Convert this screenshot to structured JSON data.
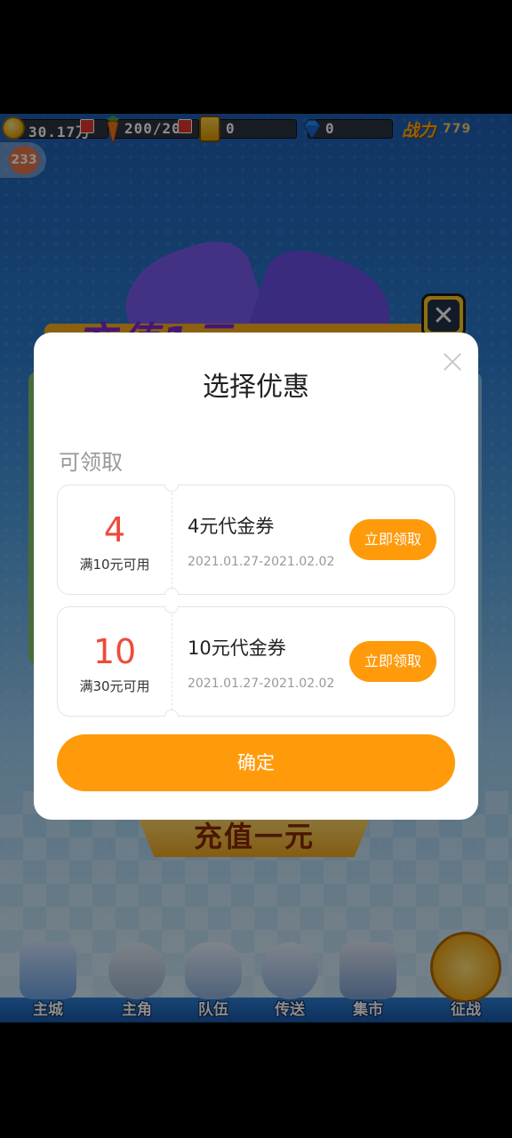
{
  "status_bar": {
    "coins": "30.17万",
    "stamina": "200/20",
    "gold": "0",
    "diamonds": "0",
    "power_label": "战力",
    "power_value": "779",
    "level": "233"
  },
  "background": {
    "banner_text": "充值1元",
    "recharge_button": "充值一元"
  },
  "nav": {
    "items": [
      {
        "label": "主城",
        "icon": "city-icon"
      },
      {
        "label": "主角",
        "icon": "hero-icon"
      },
      {
        "label": "队伍",
        "icon": "team-icon"
      },
      {
        "label": "传送",
        "icon": "teleport-icon"
      },
      {
        "label": "集市",
        "icon": "market-icon"
      },
      {
        "label": "征战",
        "icon": "expedition-icon"
      }
    ]
  },
  "modal": {
    "title": "选择优惠",
    "section_label": "可领取",
    "coupons": [
      {
        "amount": "4",
        "condition": "满10元可用",
        "name": "4元代金券",
        "date_range": "2021.01.27-2021.02.02",
        "button": "立即领取"
      },
      {
        "amount": "10",
        "condition": "满30元可用",
        "name": "10元代金券",
        "date_range": "2021.01.27-2021.02.02",
        "button": "立即领取"
      }
    ],
    "confirm_button": "确定"
  },
  "colors": {
    "accent_orange": "#ff9a0a",
    "amount_red": "#ef4a3a"
  }
}
